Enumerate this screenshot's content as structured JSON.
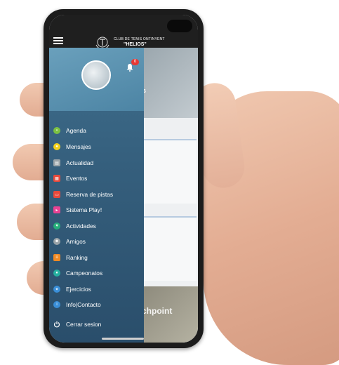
{
  "header": {
    "club_line": "CLUB DE TENIS ONTINYENT",
    "club_name": "\"HELIOS\""
  },
  "drawer": {
    "notification_count": "0",
    "items": [
      {
        "label": "Agenda",
        "icon": "agenda-icon",
        "color": "#7cc142"
      },
      {
        "label": "Mensajes",
        "icon": "chat-icon",
        "color": "#f2d11c"
      },
      {
        "label": "Actualidad",
        "icon": "news-icon",
        "color": "#9aa3a8"
      },
      {
        "label": "Eventos",
        "icon": "calendar-icon",
        "color": "#e8493b"
      },
      {
        "label": "Reserva de pistas",
        "icon": "court-icon",
        "color": "#e8493b"
      },
      {
        "label": "Sistema Play!",
        "icon": "play-icon",
        "color": "#e84393"
      },
      {
        "label": "Actividades",
        "icon": "heart-icon",
        "color": "#26b07a"
      },
      {
        "label": "Amigos",
        "icon": "friends-icon",
        "color": "#9aa3a8"
      },
      {
        "label": "Ranking",
        "icon": "ranking-icon",
        "color": "#f08a24"
      },
      {
        "label": "Campeonatos",
        "icon": "trophy-icon",
        "color": "#26b0a0"
      },
      {
        "label": "Ejercicios",
        "icon": "exercise-icon",
        "color": "#3a8fd8"
      },
      {
        "label": "Info|Contacto",
        "icon": "info-icon",
        "color": "#3a8fd8"
      },
      {
        "label": "Cerrar sesion",
        "icon": "power-icon",
        "color": "#ffffff"
      }
    ]
  },
  "background": {
    "title_partial": "as",
    "banner_partial": "chpoint"
  }
}
